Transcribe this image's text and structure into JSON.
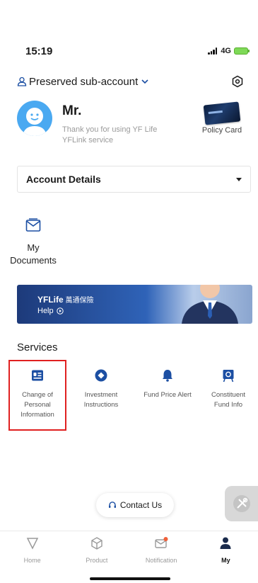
{
  "status": {
    "time": "15:19",
    "network": "4G"
  },
  "account": {
    "switch_label": "Preserved sub-account"
  },
  "profile": {
    "name": "Mr.",
    "welcome": "Thank you for using YF Life YFLink service",
    "policy_card_label": "Policy Card"
  },
  "account_details": {
    "selected": "Account Details"
  },
  "documents": {
    "label_line1": "My",
    "label_line2": "Documents"
  },
  "banner": {
    "brand": "YFLife",
    "brand_cn": "萬通保險",
    "help": "Help"
  },
  "services": {
    "title": "Services",
    "items": [
      {
        "line1": "Change of",
        "line2": "Personal",
        "line3": "Information",
        "icon": "profile-card-icon"
      },
      {
        "line1": "Investment",
        "line2": "Instructions",
        "line3": "",
        "icon": "diamond-icon"
      },
      {
        "line1": "Fund Price Alert",
        "line2": "",
        "line3": "",
        "icon": "bell-icon"
      },
      {
        "line1": "Constituent",
        "line2": "Fund Info",
        "line3": "",
        "icon": "fund-board-icon"
      }
    ]
  },
  "contact": {
    "label": "Contact Us"
  },
  "tabs": [
    {
      "label": "Home",
      "icon": "home-triangle-icon"
    },
    {
      "label": "Product",
      "icon": "product-cube-icon"
    },
    {
      "label": "Notification",
      "icon": "mail-icon"
    },
    {
      "label": "My",
      "icon": "person-icon"
    }
  ],
  "colors": {
    "accent": "#1c4fa3",
    "highlight_border": "#e02020",
    "badge": "#f0603a"
  }
}
